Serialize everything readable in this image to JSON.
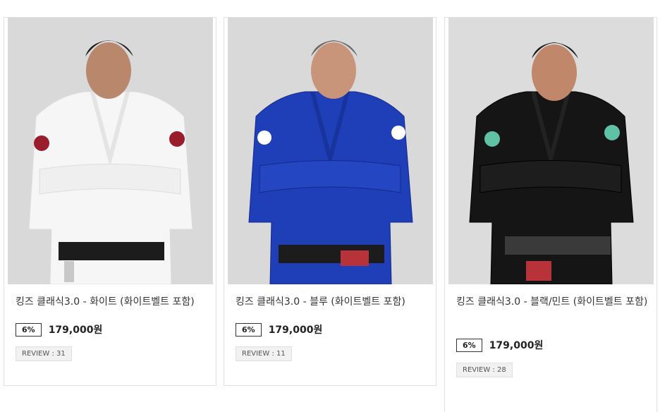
{
  "products": [
    {
      "title": "킹즈 클래식3.0 - 화이트 (화이트벨트 포함)",
      "discount": "6%",
      "price": "179,000원",
      "review": "REVIEW : 31",
      "gi_color": "#f4f4f4",
      "patch_color": "#9b1c2a"
    },
    {
      "title": "킹즈 클래식3.0 - 블루 (화이트벨트 포함)",
      "discount": "6%",
      "price": "179,000원",
      "review": "REVIEW : 11",
      "gi_color": "#1f3fb8",
      "patch_color": "#ffffff"
    },
    {
      "title": "킹즈 클래식3.0 - 블랙/민트 (화이트벨트 포함)",
      "discount": "6%",
      "price": "179,000원",
      "review": "REVIEW : 28",
      "gi_color": "#151515",
      "patch_color": "#5fc2a5"
    }
  ]
}
